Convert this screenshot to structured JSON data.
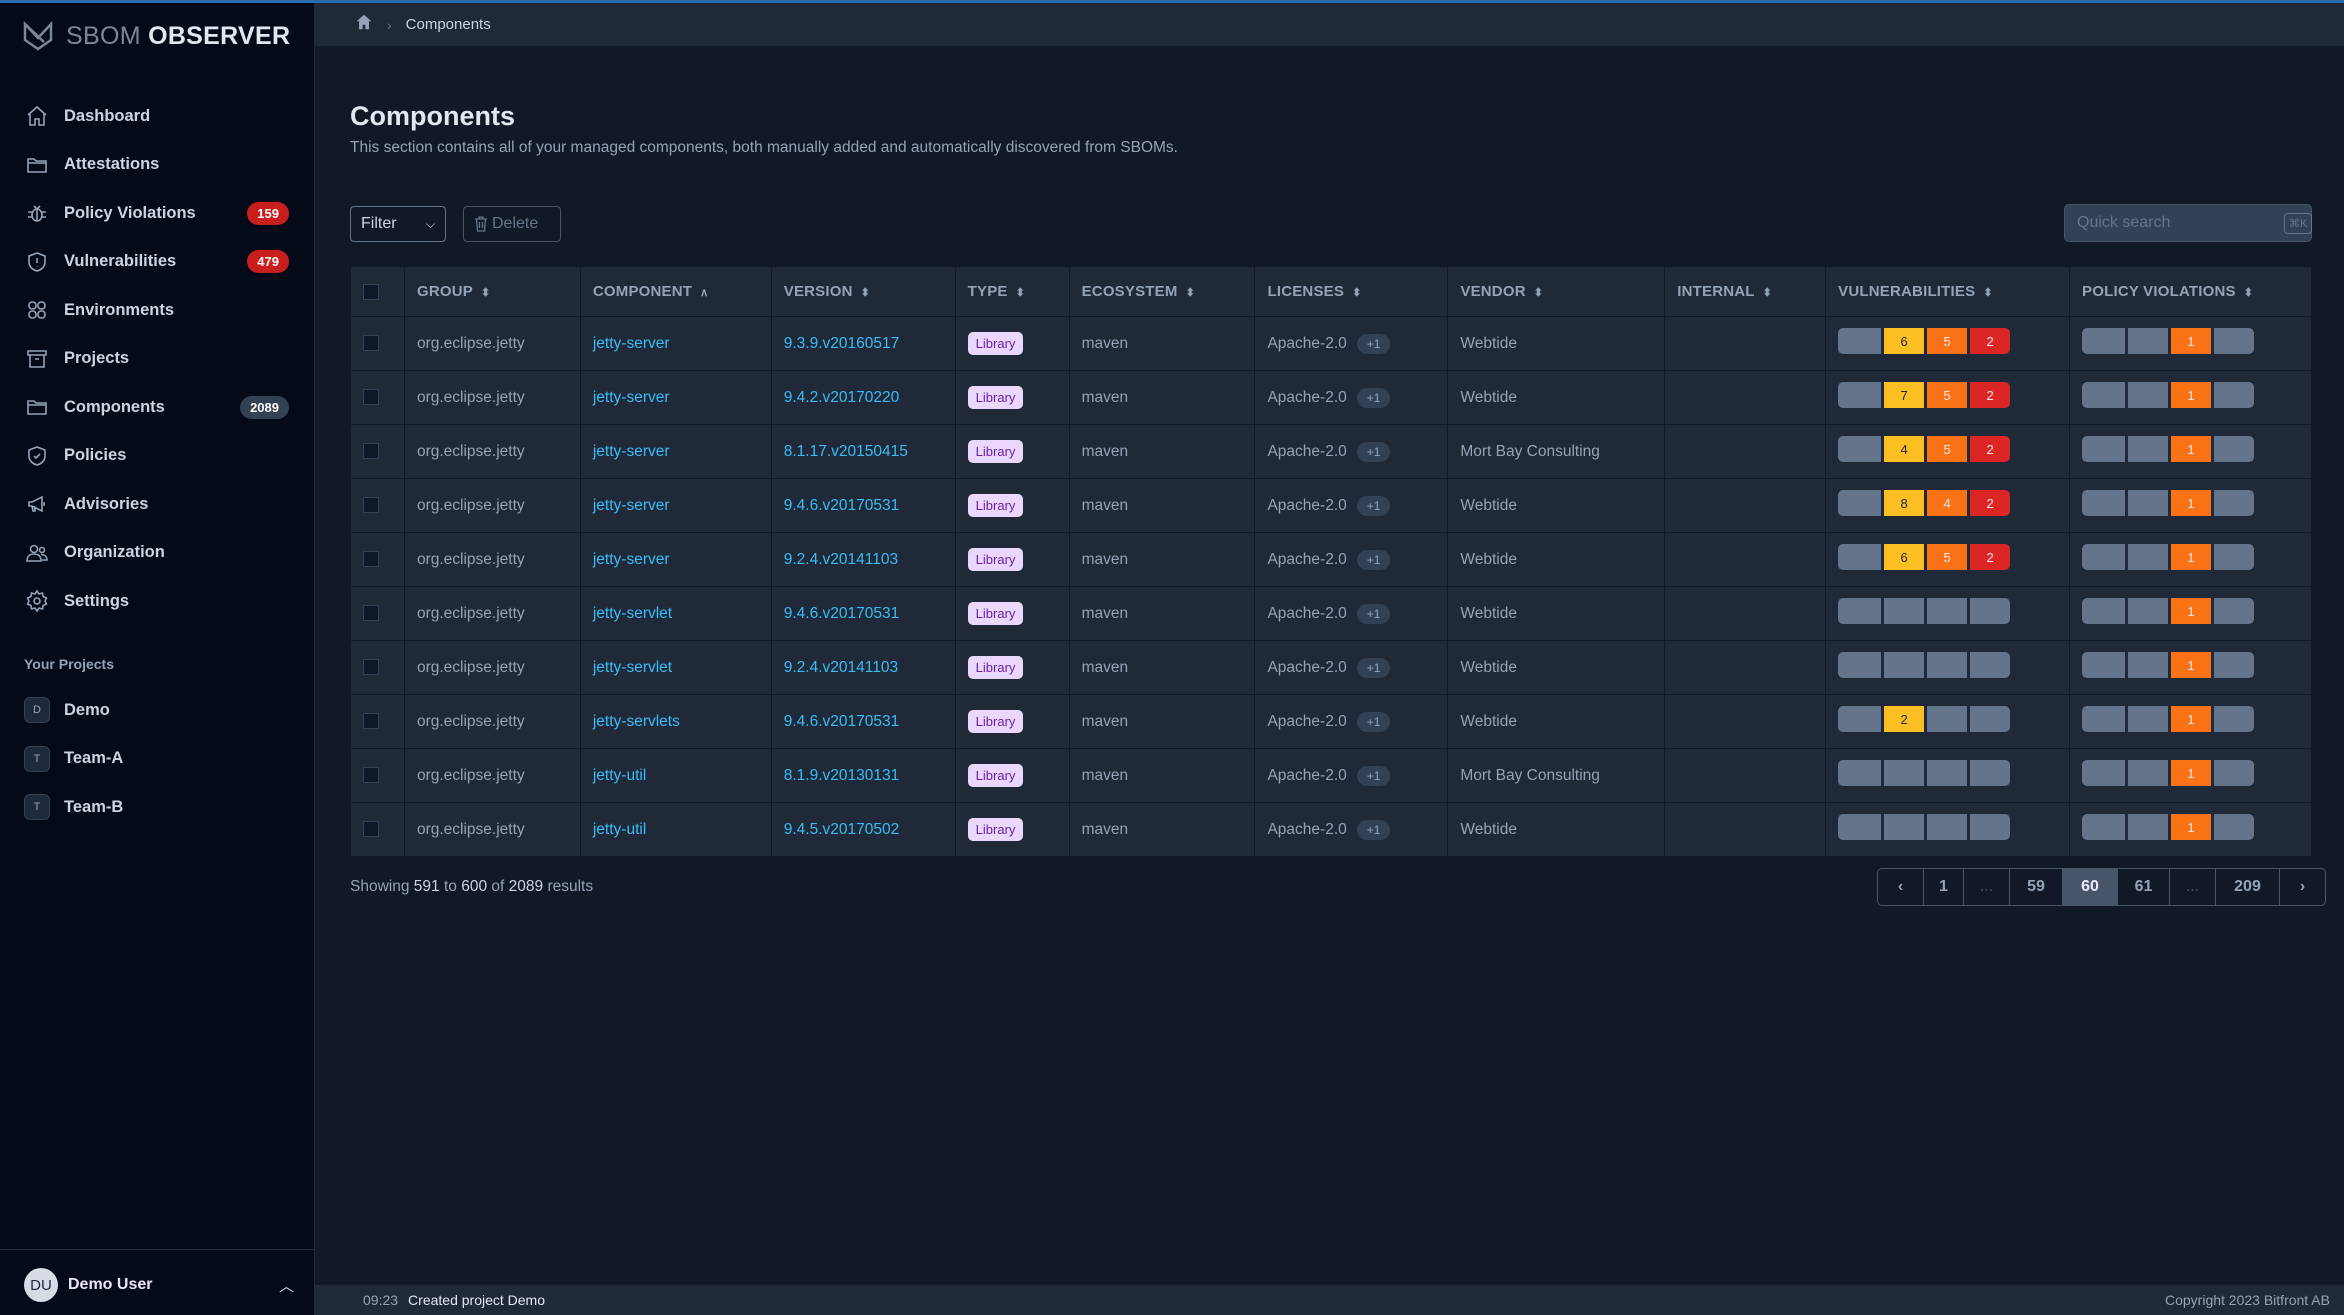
{
  "app": {
    "brand_light": "SBOM",
    "brand_bold": "OBSERVER"
  },
  "sidebar": {
    "items": [
      {
        "label": "Dashboard",
        "icon": "home-icon"
      },
      {
        "label": "Attestations",
        "icon": "folder-icon"
      },
      {
        "label": "Policy Violations",
        "icon": "bug-icon",
        "badge": "159",
        "badge_color": "#c81e1e"
      },
      {
        "label": "Vulnerabilities",
        "icon": "shield-exclamation-icon",
        "badge": "479",
        "badge_color": "#c81e1e"
      },
      {
        "label": "Environments",
        "icon": "grid-icon"
      },
      {
        "label": "Projects",
        "icon": "archive-icon"
      },
      {
        "label": "Components",
        "icon": "folder-icon",
        "badge": "2089",
        "badge_color": "#334155"
      },
      {
        "label": "Policies",
        "icon": "shield-check-icon"
      },
      {
        "label": "Advisories",
        "icon": "megaphone-icon"
      },
      {
        "label": "Organization",
        "icon": "users-icon"
      },
      {
        "label": "Settings",
        "icon": "gear-icon"
      }
    ],
    "projects_title": "Your Projects",
    "projects": [
      {
        "initial": "D",
        "name": "Demo"
      },
      {
        "initial": "T",
        "name": "Team-A"
      },
      {
        "initial": "T",
        "name": "Team-B"
      }
    ],
    "user": {
      "initials": "DU",
      "name": "Demo User"
    }
  },
  "breadcrumb": {
    "current": "Components"
  },
  "page": {
    "title": "Components",
    "subtitle": "This section contains all of your managed components, both manually added and automatically discovered from SBOMs."
  },
  "toolbar": {
    "filter_label": "Filter",
    "delete_label": "Delete",
    "search_placeholder": "Quick search",
    "search_shortcut": "⌘K"
  },
  "table": {
    "columns": [
      {
        "label": "GROUP",
        "sort": "none"
      },
      {
        "label": "COMPONENT",
        "sort": "asc"
      },
      {
        "label": "VERSION",
        "sort": "none"
      },
      {
        "label": "TYPE",
        "sort": "none"
      },
      {
        "label": "ECOSYSTEM",
        "sort": "none"
      },
      {
        "label": "LICENSES",
        "sort": "none"
      },
      {
        "label": "VENDOR",
        "sort": "none"
      },
      {
        "label": "INTERNAL",
        "sort": "none"
      },
      {
        "label": "VULNERABILITIES",
        "sort": "none"
      },
      {
        "label": "POLICY VIOLATIONS",
        "sort": "none"
      }
    ],
    "rows": [
      {
        "group": "org.eclipse.jetty",
        "component": "jetty-server",
        "version": "9.3.9.v20160517",
        "type": "Library",
        "ecosystem": "maven",
        "license": "Apache-2.0",
        "license_more": "+1",
        "vendor": "Webtide",
        "internal": "",
        "vulns": [
          "",
          "6",
          "5",
          "2"
        ],
        "violations": [
          "",
          "",
          "1",
          ""
        ]
      },
      {
        "group": "org.eclipse.jetty",
        "component": "jetty-server",
        "version": "9.4.2.v20170220",
        "type": "Library",
        "ecosystem": "maven",
        "license": "Apache-2.0",
        "license_more": "+1",
        "vendor": "Webtide",
        "internal": "",
        "vulns": [
          "",
          "7",
          "5",
          "2"
        ],
        "violations": [
          "",
          "",
          "1",
          ""
        ]
      },
      {
        "group": "org.eclipse.jetty",
        "component": "jetty-server",
        "version": "8.1.17.v20150415",
        "type": "Library",
        "ecosystem": "maven",
        "license": "Apache-2.0",
        "license_more": "+1",
        "vendor": "Mort Bay Consulting",
        "internal": "",
        "vulns": [
          "",
          "4",
          "5",
          "2"
        ],
        "violations": [
          "",
          "",
          "1",
          ""
        ]
      },
      {
        "group": "org.eclipse.jetty",
        "component": "jetty-server",
        "version": "9.4.6.v20170531",
        "type": "Library",
        "ecosystem": "maven",
        "license": "Apache-2.0",
        "license_more": "+1",
        "vendor": "Webtide",
        "internal": "",
        "vulns": [
          "",
          "8",
          "4",
          "2"
        ],
        "violations": [
          "",
          "",
          "1",
          ""
        ]
      },
      {
        "group": "org.eclipse.jetty",
        "component": "jetty-server",
        "version": "9.2.4.v20141103",
        "type": "Library",
        "ecosystem": "maven",
        "license": "Apache-2.0",
        "license_more": "+1",
        "vendor": "Webtide",
        "internal": "",
        "vulns": [
          "",
          "6",
          "5",
          "2"
        ],
        "violations": [
          "",
          "",
          "1",
          ""
        ]
      },
      {
        "group": "org.eclipse.jetty",
        "component": "jetty-servlet",
        "version": "9.4.6.v20170531",
        "type": "Library",
        "ecosystem": "maven",
        "license": "Apache-2.0",
        "license_more": "+1",
        "vendor": "Webtide",
        "internal": "",
        "vulns": [
          "",
          "",
          "",
          ""
        ],
        "violations": [
          "",
          "",
          "1",
          ""
        ]
      },
      {
        "group": "org.eclipse.jetty",
        "component": "jetty-servlet",
        "version": "9.2.4.v20141103",
        "type": "Library",
        "ecosystem": "maven",
        "license": "Apache-2.0",
        "license_more": "+1",
        "vendor": "Webtide",
        "internal": "",
        "vulns": [
          "",
          "",
          "",
          ""
        ],
        "violations": [
          "",
          "",
          "1",
          ""
        ]
      },
      {
        "group": "org.eclipse.jetty",
        "component": "jetty-servlets",
        "version": "9.4.6.v20170531",
        "type": "Library",
        "ecosystem": "maven",
        "license": "Apache-2.0",
        "license_more": "+1",
        "vendor": "Webtide",
        "internal": "",
        "vulns": [
          "",
          "2",
          "",
          ""
        ],
        "violations": [
          "",
          "",
          "1",
          ""
        ]
      },
      {
        "group": "org.eclipse.jetty",
        "component": "jetty-util",
        "version": "8.1.9.v20130131",
        "type": "Library",
        "ecosystem": "maven",
        "license": "Apache-2.0",
        "license_more": "+1",
        "vendor": "Mort Bay Consulting",
        "internal": "",
        "vulns": [
          "",
          "",
          "",
          ""
        ],
        "violations": [
          "",
          "",
          "1",
          ""
        ]
      },
      {
        "group": "org.eclipse.jetty",
        "component": "jetty-util",
        "version": "9.4.5.v20170502",
        "type": "Library",
        "ecosystem": "maven",
        "license": "Apache-2.0",
        "license_more": "+1",
        "vendor": "Webtide",
        "internal": "",
        "vulns": [
          "",
          "",
          "",
          ""
        ],
        "violations": [
          "",
          "",
          "1",
          ""
        ]
      }
    ],
    "severity_colors": {
      "critical": "#64748b",
      "high": "#fbbf24",
      "medium": "#f97316",
      "low": "#dc2626",
      "empty": "#64748b"
    }
  },
  "pagination": {
    "showing_prefix": "Showing",
    "from": "591",
    "to_word": "to",
    "to": "600",
    "of_word": "of",
    "total": "2089",
    "suffix": "results",
    "pages": [
      "‹",
      "1",
      "...",
      "59",
      "60",
      "61",
      "...",
      "209",
      "›"
    ],
    "current": "60"
  },
  "footer": {
    "time": "09:23",
    "message": "Created project Demo",
    "copyright": "Copyright 2023 Bitfront AB"
  }
}
